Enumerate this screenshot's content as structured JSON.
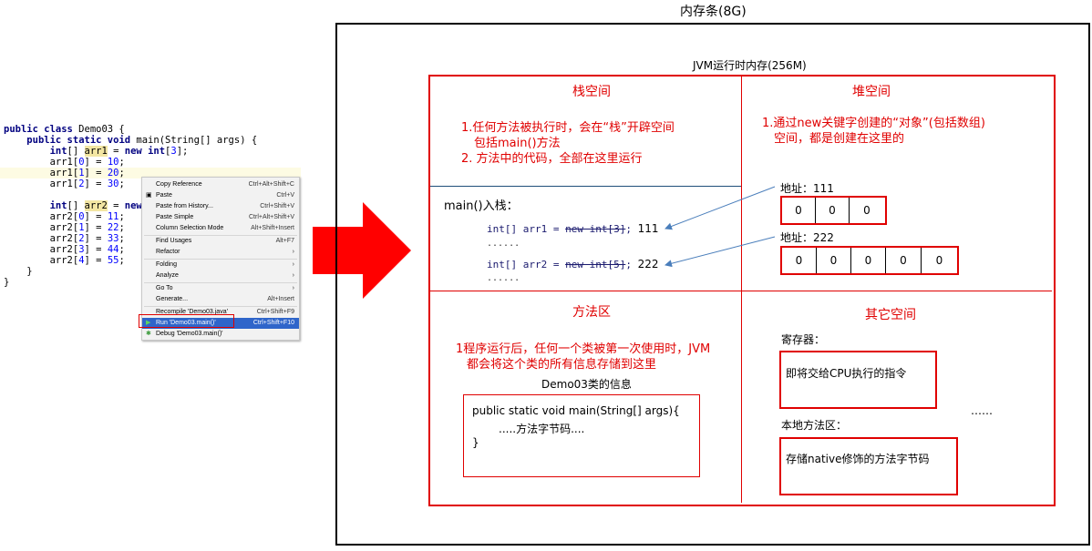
{
  "editor": {
    "lines": [
      "public class Demo03 {",
      "    public static void main(String[] args) {",
      "        int[] arr1 = new int[3];",
      "        arr1[0] = 10;",
      "        arr1[1] = 20;",
      "        arr1[2] = 30;",
      "",
      "        int[] arr2 = new",
      "        arr2[0] = 11;",
      "        arr2[1] = 22;",
      "        arr2[2] = 33;",
      "        arr2[3] = 44;",
      "        arr2[4] = 55;",
      "    }",
      "}"
    ]
  },
  "context_menu": {
    "items": [
      {
        "label": "Copy Reference",
        "shortcut": "Ctrl+Alt+Shift+C"
      },
      {
        "label": "Paste",
        "shortcut": "Ctrl+V"
      },
      {
        "label": "Paste from History...",
        "shortcut": "Ctrl+Shift+V"
      },
      {
        "label": "Paste Simple",
        "shortcut": "Ctrl+Alt+Shift+V"
      },
      {
        "label": "Column Selection Mode",
        "shortcut": "Alt+Shift+Insert"
      },
      {
        "label": "Find Usages",
        "shortcut": "Alt+F7"
      },
      {
        "label": "Refactor",
        "shortcut": "›"
      },
      {
        "label": "Folding",
        "shortcut": "›"
      },
      {
        "label": "Analyze",
        "shortcut": "›"
      },
      {
        "label": "Go To",
        "shortcut": "›"
      },
      {
        "label": "Generate...",
        "shortcut": "Alt+Insert"
      },
      {
        "label": "Recompile 'Demo03.java'",
        "shortcut": "Ctrl+Shift+F9"
      },
      {
        "label": "Run 'Demo03.main()'",
        "shortcut": "Ctrl+Shift+F10"
      },
      {
        "label": "Debug 'Demo03.main()'",
        "shortcut": ""
      }
    ]
  },
  "diagram": {
    "memory_title": "内存条(8G)",
    "jvm_title": "JVM运行时内存(256M)",
    "stack": {
      "title": "栈空间",
      "note1": "1.任何方法被执行时，会在“栈”开辟空间",
      "note1b": "包括main()方法",
      "note2": "2. 方法中的代码，全部在这里运行",
      "push_label": "main()入栈：",
      "line1_code": "int[] arr1 = ",
      "line1_strike": "new int[3]",
      "line1_suffix": ";",
      "line1_addr": "111",
      "line2_code": "int[] arr2 = ",
      "line2_strike": "new int[5]",
      "line2_suffix": ";",
      "line2_addr": "222",
      "ellipsis": "......"
    },
    "heap": {
      "title": "堆空间",
      "note1": "1.通过new关键字创建的“对象”(包括数组)",
      "note1b": "空间，都是创建在这里的",
      "addr1_label": "地址：111",
      "addr1_values": [
        "0",
        "0",
        "0"
      ],
      "addr2_label": "地址：222",
      "addr2_values": [
        "0",
        "0",
        "0",
        "0",
        "0"
      ]
    },
    "method_area": {
      "title": "方法区",
      "note1": "1程序运行后，任何一个类被第一次使用时，JVM",
      "note1b": "都会将这个类的所有信息存储到这里",
      "class_info_title": "Demo03类的信息",
      "code_line1": "public static void main(String[]  args){",
      "code_line2": ".....方法字节码....",
      "code_line3": "}"
    },
    "other": {
      "title": "其它空间",
      "register_label": "寄存器：",
      "register_text": "即将交给CPU执行的指令",
      "native_label": "本地方法区：",
      "native_text": "存储native修饰的方法字节码",
      "ellipsis": "……"
    }
  },
  "colors": {
    "accent": "#e00000",
    "arrow": "#ff0000",
    "connector": "#4a7ebb",
    "menu_selected": "#2f65ca"
  }
}
